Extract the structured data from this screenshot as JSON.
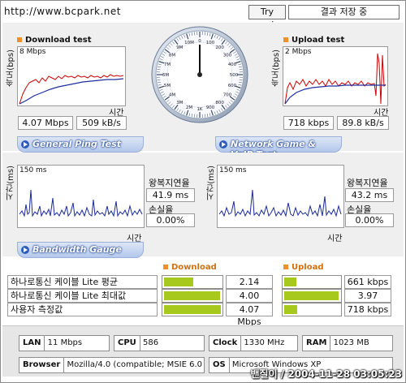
{
  "header": {
    "url": "http://www.bcpark.net",
    "try_again": "Try again",
    "save_result": "결과 저장 중"
  },
  "download": {
    "title": "Download test",
    "y_axis": "속도(bps)",
    "scale": "8 Mbps",
    "x_axis": "시간",
    "mbps": "4.07 Mbps",
    "kbs": "509 kB/s"
  },
  "upload": {
    "title": "Upload test",
    "y_axis": "속도(bps)",
    "scale": "2 Mbps",
    "x_axis": "시간",
    "kbps": "718 kbps",
    "kbs": "89.8 kB/s"
  },
  "gauge": {
    "ticks": [
      "0",
      "100",
      "200",
      "300",
      "400",
      "500",
      "600",
      "700",
      "800",
      "900",
      "1K",
      "2M",
      "3M",
      "4M",
      "5M",
      "6M",
      "7M",
      "8M",
      "9M",
      "10M"
    ],
    "needle_value": "0"
  },
  "tabs": {
    "ping": "General Ping Test",
    "game": "Network Game & VoIP Test",
    "bandwidth": "Bandwidth Gauge"
  },
  "ping": {
    "y_axis": "시간(ms)",
    "scale": "150 ms",
    "x_axis": "시간",
    "rtt_label": "왕복지연율",
    "rtt_value": "41.9 ms",
    "loss_label": "손실율",
    "loss_value": "0.00%"
  },
  "game": {
    "y_axis": "시간(ms)",
    "scale": "150 ms",
    "x_axis": "시간",
    "rtt_label": "왕복지연율",
    "rtt_value": "43.2 ms",
    "loss_label": "손실율",
    "loss_value": "0.00%"
  },
  "bandwidth": {
    "download_header": "Download",
    "upload_header": "Upload",
    "rows": [
      {
        "label": "하나로통신 케이블 Lite 평균",
        "down": "2.14 Mbps",
        "down_frac": 0.52,
        "up": "661 kbps",
        "up_frac": 0.22
      },
      {
        "label": "하나로통신 케이블 Lite 최대값",
        "down": "4.00 Mbps",
        "down_frac": 0.98,
        "up": "3.97 Mbps",
        "up_frac": 0.98
      },
      {
        "label": "사용자 측정값",
        "down": "4.07 Mbps",
        "down_frac": 1.0,
        "up": "718 kbps",
        "up_frac": 0.24
      }
    ]
  },
  "sysinfo": {
    "lan_label": "LAN",
    "lan_value": "11 Mbps",
    "cpu_label": "CPU",
    "cpu_value": "586",
    "clock_label": "Clock",
    "clock_value": "1330 MHz",
    "ram_label": "RAM",
    "ram_value": "1023 MB",
    "browser_label": "Browser",
    "browser_value": "Mozilla/4.0 (compatible; MSIE 6.0",
    "os_label": "OS",
    "os_value": "Microsoft Windows XP"
  },
  "footer": {
    "watermark": "밴질이 / 2004-11-28 03:05:23"
  },
  "colors": {
    "download_line": "#cc0000",
    "average_line": "#1e2fa0",
    "ping_line": "#1a2a9a",
    "bar_fill": "#a7c81d",
    "accent": "#f0902a"
  }
}
